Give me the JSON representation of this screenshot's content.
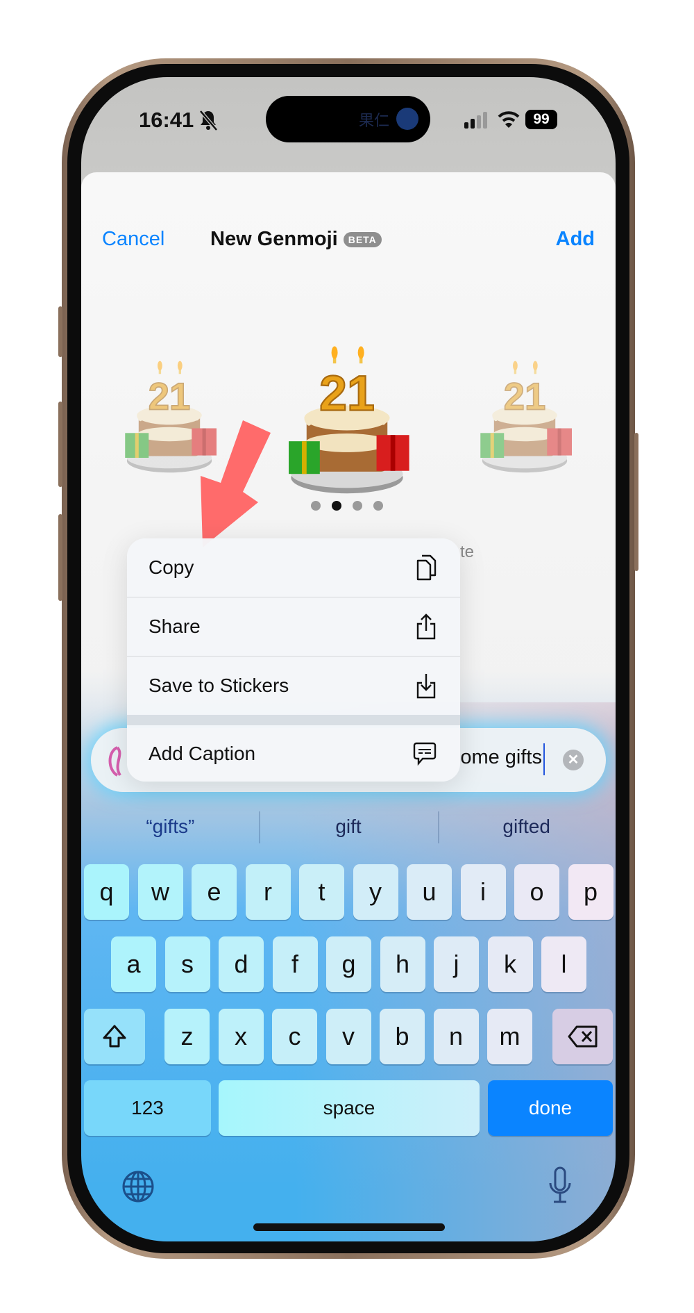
{
  "status_bar": {
    "time": "16:41",
    "silent_icon": "bell-slash-icon",
    "battery": "99",
    "island_text": "果仁"
  },
  "header": {
    "cancel": "Cancel",
    "title": "New Genmoji",
    "badge": "BETA",
    "add": "Add"
  },
  "carousel": {
    "page_count": 4,
    "current_page": 2
  },
  "hidden_label_fragment": "te",
  "context_menu": {
    "items": [
      {
        "label": "Copy",
        "icon": "copy-icon"
      },
      {
        "label": "Share",
        "icon": "share-icon"
      },
      {
        "label": "Save to Stickers",
        "icon": "save-sticker-icon"
      },
      {
        "label": "Add Caption",
        "icon": "caption-icon"
      }
    ]
  },
  "prompt_field": {
    "value": "ome gifts",
    "clear_icon": "clear-icon"
  },
  "suggestions": [
    "“gifts”",
    "gift",
    "gifted"
  ],
  "keyboard": {
    "rows": [
      [
        "q",
        "w",
        "e",
        "r",
        "t",
        "y",
        "u",
        "i",
        "o",
        "p"
      ],
      [
        "a",
        "s",
        "d",
        "f",
        "g",
        "h",
        "j",
        "k",
        "l"
      ],
      [
        "z",
        "x",
        "c",
        "v",
        "b",
        "n",
        "m"
      ]
    ],
    "numbers": "123",
    "space": "space",
    "done": "done",
    "done_color": "#0a84ff"
  },
  "colors": {
    "accent": "#0a84ff",
    "arrow": "#ff6b6b"
  }
}
